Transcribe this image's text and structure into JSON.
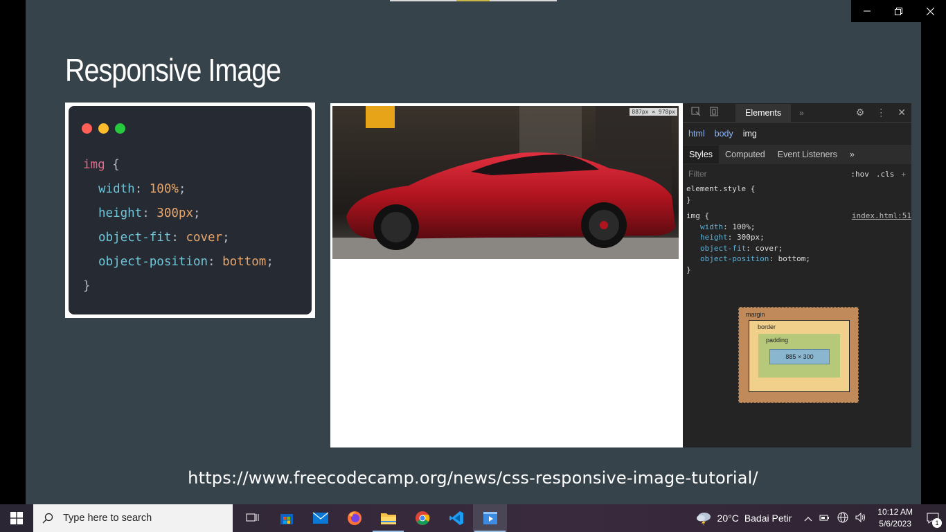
{
  "window": {
    "minimize_icon": "minimize-icon",
    "restore_icon": "restore-icon",
    "close_icon": "close-icon"
  },
  "slide": {
    "title": "Responsive Image",
    "url": "https://www.freecodecamp.org/news/css-responsive-image-tutorial/"
  },
  "code": {
    "selector": "img",
    "open_brace": "{",
    "close_brace": "}",
    "lines": [
      {
        "prop": "width",
        "value": "100%"
      },
      {
        "prop": "height",
        "value": "300px"
      },
      {
        "prop": "object-fit",
        "value": "cover"
      },
      {
        "prop": "object-position",
        "value": "bottom"
      }
    ],
    "dot_colors": [
      "#ff5f56",
      "#ffbd2e",
      "#27c93f"
    ]
  },
  "browser": {
    "dims_badge": "887px × 978px"
  },
  "devtools": {
    "tab_elements": "Elements",
    "more": "»",
    "breadcrumbs": [
      "html",
      "body",
      "img"
    ],
    "subtabs": [
      "Styles",
      "Computed",
      "Event Listeners",
      "»"
    ],
    "filter_placeholder": "Filter",
    "hov": ":hov",
    "cls": ".cls",
    "plus": "+",
    "element_style_open": "element.style {",
    "element_style_close": "}",
    "rule_selector": "img {",
    "rule_source": "index.html:51",
    "rule_close": "}",
    "rule_lines": [
      {
        "prop": "width",
        "value": "100%;"
      },
      {
        "prop": "height",
        "value": "300px;"
      },
      {
        "prop": "object-fit",
        "value": "cover;"
      },
      {
        "prop": "object-position",
        "value": "bottom;"
      }
    ],
    "boxmodel": {
      "margin_label": "margin",
      "border_label": "border",
      "padding_label": "padding",
      "content": "885 × 300",
      "dash": "-"
    }
  },
  "taskbar": {
    "search_placeholder": "Type here to search",
    "apps": [
      "task-view-icon",
      "store-icon",
      "mail-icon",
      "firefox-icon",
      "file-explorer-icon",
      "chrome-icon",
      "vscode-icon",
      "media-player-icon"
    ],
    "weather_temp": "20°C",
    "weather_desc": "Badai Petir",
    "time": "10:12 AM",
    "date": "5/6/2023",
    "notification_count": "1"
  }
}
